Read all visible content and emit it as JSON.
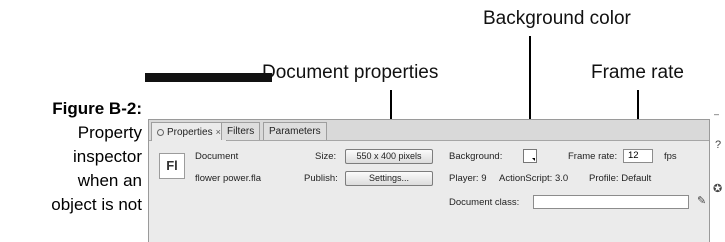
{
  "callouts": {
    "background_color": "Background color",
    "document_properties": "Document properties",
    "frame_rate": "Frame rate"
  },
  "caption": {
    "figure": "Figure B-2:",
    "lines": [
      "Property",
      "inspector",
      "when an",
      "object is not"
    ]
  },
  "panel": {
    "tabs": [
      {
        "label": "Properties",
        "close": "×"
      },
      {
        "label": "Filters"
      },
      {
        "label": "Parameters"
      }
    ],
    "doc_icon": "Fl",
    "document_label": "Document",
    "file_name": "flower power.fla",
    "size_label": "Size:",
    "size_value": "550 x 400 pixels",
    "publish_label": "Publish:",
    "settings_button": "Settings...",
    "background_label": "Background:",
    "background_color": "#ffffff",
    "frame_rate_label": "Frame rate:",
    "frame_rate_value": "12",
    "fps_label": "fps",
    "player_label": "Player: 9",
    "actionscript_label": "ActionScript: 3.0",
    "profile_label": "Profile: Default",
    "document_class_label": "Document class:",
    "document_class_value": ""
  },
  "icons": {
    "help": "?",
    "edit": "pencil-icon",
    "target": "target-icon"
  }
}
